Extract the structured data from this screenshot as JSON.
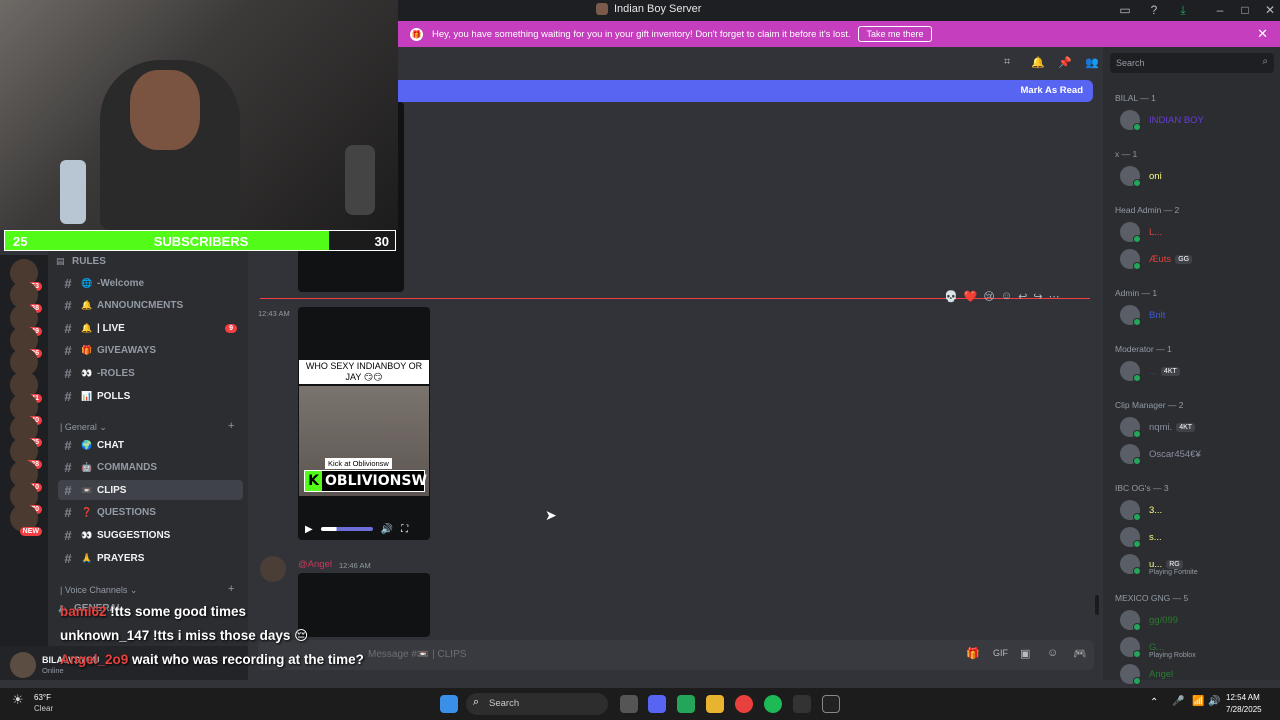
{
  "window": {
    "title": "Indian Boy Server"
  },
  "banner": {
    "text": "Hey, you have something waiting for you in your gift inventory! Don't forget to claim it before it's lost.",
    "button": "Take me there",
    "close": "✕"
  },
  "toolbar": {
    "search_placeholder": "Search"
  },
  "markbar": {
    "label": "Mark As Read"
  },
  "webcam": {
    "subs_current": "25",
    "subs_label": "SUBSCRIBERS",
    "subs_goal": "30",
    "progress": 0.83
  },
  "servers": [
    {
      "badge": "153"
    },
    {
      "badge": "38"
    },
    {
      "badge": "249"
    },
    {
      "badge": "426"
    },
    {
      "badge": ""
    },
    {
      "badge": "41"
    },
    {
      "badge": "240"
    },
    {
      "badge": "285"
    },
    {
      "badge": "128"
    },
    {
      "badge": "10"
    },
    {
      "badge": "170"
    },
    {
      "badge": "NEW"
    }
  ],
  "channels": {
    "rules": "RULES",
    "items": [
      {
        "emoji": "🌐",
        "label": "-Welcome"
      },
      {
        "emoji": "🔔",
        "label": "ANNOUNCMENTS"
      },
      {
        "emoji": "🔔",
        "label": "| LIVE",
        "pill": "9"
      },
      {
        "emoji": "🎁",
        "label": "GIVEAWAYS"
      },
      {
        "emoji": "👀",
        "label": "-ROLES"
      },
      {
        "emoji": "📊",
        "label": "POLLS"
      }
    ],
    "cat_general": "| General",
    "general": [
      {
        "emoji": "🌍",
        "label": "CHAT"
      },
      {
        "emoji": "🤖",
        "label": "COMMANDS"
      },
      {
        "emoji": "📼",
        "label": "CLIPS"
      },
      {
        "emoji": "❓",
        "label": "QUESTIONS"
      },
      {
        "emoji": "👀",
        "label": "SUGGESTIONS"
      },
      {
        "emoji": "🙏",
        "label": "PRAYERS"
      }
    ],
    "cat_voice": "| Voice Channels",
    "voice_first": "GENERAL"
  },
  "user": {
    "name": "BILALVSYOU",
    "status": "Online"
  },
  "messages": {
    "time1": "12:43 AM",
    "video_caption": "WHO SEXY INDIANBOY OR JAY 😏😏",
    "video_kick": "Kick at Oblivionsw",
    "video_logo": "OBLIVIONSW",
    "author2": "@Angel",
    "time2": "12:46 AM"
  },
  "composer": {
    "placeholder": "Message #📼 | CLIPS"
  },
  "members": {
    "roles": [
      {
        "label": "BILAL — 1",
        "members": [
          {
            "name": "INDIAN BOY",
            "color": "#6a3bd6"
          }
        ]
      },
      {
        "label": "x — 1",
        "members": [
          {
            "name": "oni",
            "color": "#fefe7f"
          }
        ]
      },
      {
        "label": "Head Admin — 2",
        "members": [
          {
            "name": "L...",
            "color": "#e8413d"
          },
          {
            "name": "Æuts",
            "color": "#e8413d",
            "tag": "GG"
          }
        ]
      },
      {
        "label": "Admin — 1",
        "members": [
          {
            "name": "Bnlt",
            "color": "#3b5bd6"
          }
        ]
      },
      {
        "label": "Moderator — 1",
        "members": [
          {
            "name": "...",
            "color": "#3a3e9a",
            "tag": "4KT"
          }
        ]
      },
      {
        "label": "Clip Manager — 2",
        "members": [
          {
            "name": "nqmi.",
            "color": "#8a8ea0",
            "tag": "4KT"
          },
          {
            "name": "Oscar454€¥",
            "color": "#8a8ea0"
          }
        ]
      },
      {
        "label": "IBC OG's — 3",
        "members": [
          {
            "name": "3...",
            "color": "#fefe7f"
          },
          {
            "name": "s...",
            "color": "#fefe7f"
          },
          {
            "name": "u...",
            "color": "#fefe7f",
            "tag": "RG",
            "sub": "Playing Fortnite"
          }
        ]
      },
      {
        "label": "MEXICO GNG — 5",
        "members": [
          {
            "name": "gg/099",
            "color": "#2a7a30"
          },
          {
            "name": "G...",
            "color": "#2a7a30",
            "sub": "Playing Roblox"
          },
          {
            "name": "Angel",
            "color": "#2a7a30"
          }
        ]
      }
    ]
  },
  "overlay_chat": [
    {
      "user": "baml62",
      "text": "!tts some good times",
      "red": true
    },
    {
      "user": "unknown_147",
      "text": "!tts i miss those days 😔",
      "red": false
    },
    {
      "user": "Angel_2o9",
      "text": "wait who was recording at the time?",
      "red": true
    }
  ],
  "taskbar": {
    "weather": "63°F",
    "weather_desc": "Clear",
    "search": "Search",
    "time": "12:54 AM",
    "date": "7/28/2025"
  }
}
